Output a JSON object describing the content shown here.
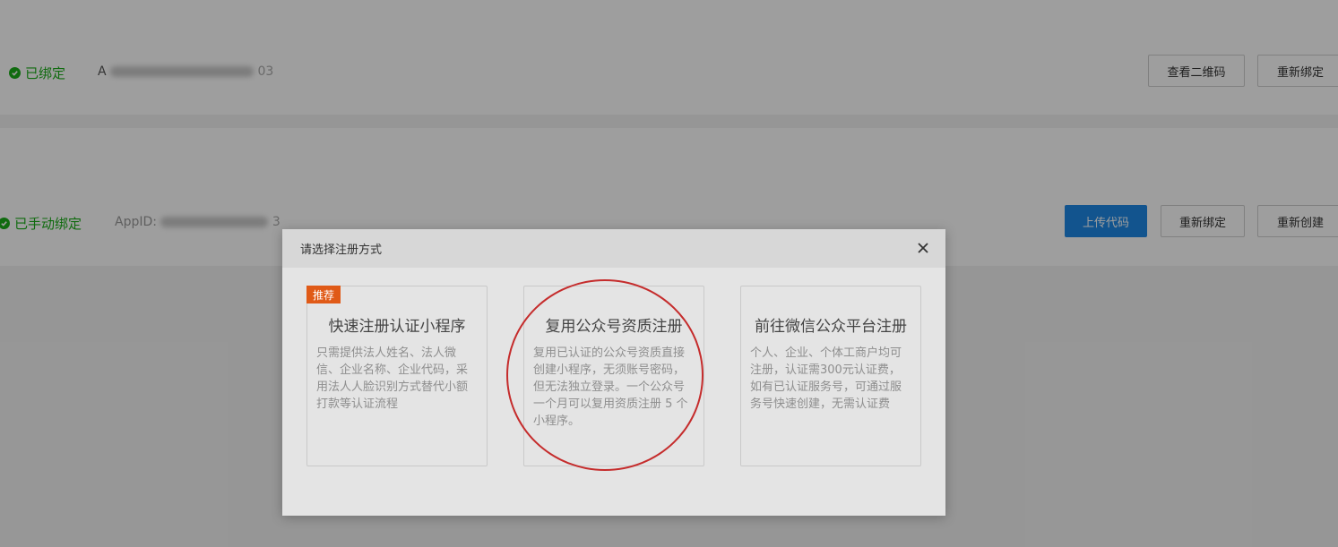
{
  "row1": {
    "status": "已绑定",
    "appid_prefix": "A",
    "appid_suffix": "03",
    "buttons": [
      "查看二维码",
      "重新绑定"
    ]
  },
  "row2": {
    "status": "已手动绑定",
    "appid_prefix": "AppID:",
    "appid_suffix": "3",
    "buttons": [
      "上传代码",
      "重新绑定",
      "重新创建"
    ]
  },
  "modal": {
    "title": "请选择注册方式",
    "close_icon": "close-icon",
    "cards": [
      {
        "tag": "推荐",
        "title": "快速注册认证小程序",
        "desc": "只需提供法人姓名、法人微信、企业名称、企业代码，采用法人人脸识别方式替代小额打款等认证流程"
      },
      {
        "title": "复用公众号资质注册",
        "desc": "复用已认证的公众号资质直接创建小程序，无须账号密码，但无法独立登录。一个公众号一个月可以复用资质注册 5 个小程序。"
      },
      {
        "title": "前往微信公众平台注册",
        "desc": "个人、企业、个体工商户均可注册，认证需300元认证费，如有已认证服务号，可通过服务号快速创建，无需认证费"
      }
    ]
  },
  "colors": {
    "success": "#1aad19",
    "primary": "#1e88e5",
    "tag": "#e05a17",
    "annotation": "#c52c2c"
  }
}
